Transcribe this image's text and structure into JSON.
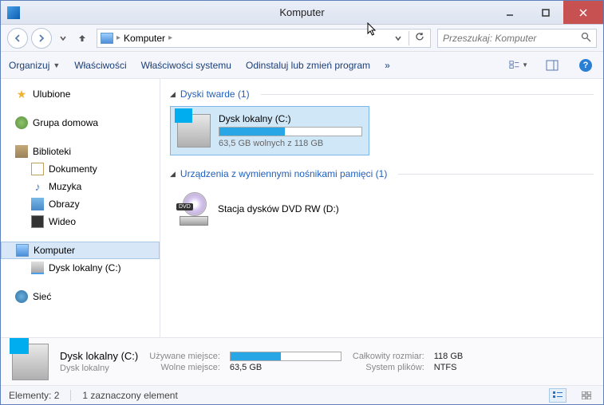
{
  "window": {
    "title": "Komputer"
  },
  "breadcrumb": {
    "item1": "Komputer"
  },
  "search": {
    "placeholder": "Przeszukaj: Komputer"
  },
  "toolbar": {
    "organize": "Organizuj",
    "properties": "Właściwości",
    "system_props": "Właściwości systemu",
    "uninstall": "Odinstaluj lub zmień program",
    "overflow": "»"
  },
  "sidebar": {
    "favorites": "Ulubione",
    "homegroup": "Grupa domowa",
    "libraries": "Biblioteki",
    "documents": "Dokumenty",
    "music": "Muzyka",
    "pictures": "Obrazy",
    "videos": "Wideo",
    "computer": "Komputer",
    "local_disk": "Dysk lokalny (C:)",
    "network": "Sieć"
  },
  "groups": {
    "hard_drives": "Dyski twarde (1)",
    "removable": "Urządzenia z wymiennymi nośnikami pamięci (1)"
  },
  "drives": {
    "c": {
      "name": "Dysk lokalny (C:)",
      "free_text": "63,5 GB wolnych z 118 GB",
      "fill_percent": 46
    },
    "dvd": {
      "name": "Stacja dysków DVD RW (D:)",
      "badge": "DVD"
    }
  },
  "details": {
    "name": "Dysk lokalny (C:)",
    "type": "Dysk lokalny",
    "used_label": "Używane miejsce:",
    "free_label": "Wolne miejsce:",
    "free_value": "63,5 GB",
    "total_label": "Całkowity rozmiar:",
    "total_value": "118 GB",
    "fs_label": "System plików:",
    "fs_value": "NTFS",
    "fill_percent": 46
  },
  "status": {
    "items": "Elementy: 2",
    "selected": "1 zaznaczony element"
  }
}
